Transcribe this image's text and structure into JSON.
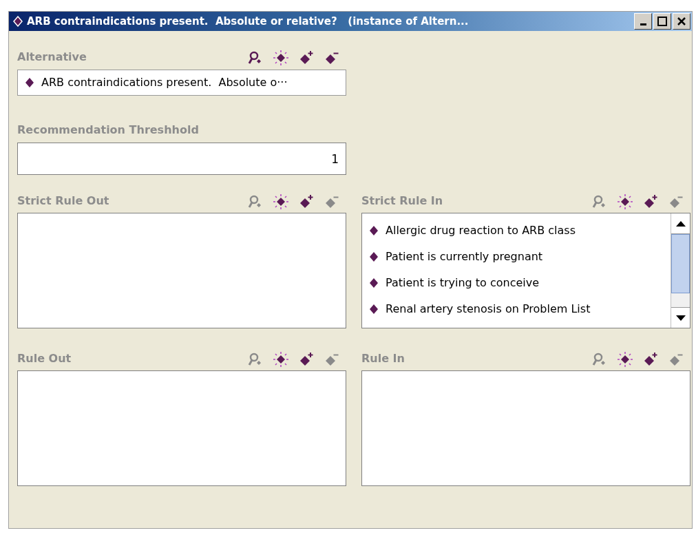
{
  "window": {
    "title": "ARB contraindications present.  Absolute or relative?   (instance of Altern...",
    "buttons": [
      {
        "kind": "minimize"
      },
      {
        "kind": "maximize"
      },
      {
        "kind": "close"
      }
    ]
  },
  "alternative": {
    "label": "Alternative",
    "tools": [
      {
        "kind": "find",
        "disabled": false
      },
      {
        "kind": "view",
        "disabled": false
      },
      {
        "kind": "add",
        "disabled": false
      },
      {
        "kind": "remove",
        "disabled": false
      }
    ],
    "items": [
      "ARB contraindications present.  Absolute o···"
    ]
  },
  "threshold": {
    "label": "Recommendation Threshhold",
    "value": "1"
  },
  "panels": [
    {
      "label": "Strict Rule Out",
      "tools": [
        {
          "kind": "find",
          "disabled": true
        },
        {
          "kind": "view",
          "disabled": false
        },
        {
          "kind": "add",
          "disabled": false
        },
        {
          "kind": "remove",
          "disabled": true
        }
      ]
    },
    {
      "label": "Strict Rule In",
      "tools": [
        {
          "kind": "find",
          "disabled": true
        },
        {
          "kind": "view",
          "disabled": false
        },
        {
          "kind": "add",
          "disabled": false
        },
        {
          "kind": "remove",
          "disabled": true
        }
      ],
      "items": [
        "Allergic drug reaction to ARB class",
        "Patient is currently pregnant",
        "Patient is trying to conceive",
        "Renal artery stenosis on Problem List"
      ]
    },
    {
      "label": "Rule Out",
      "tools": [
        {
          "kind": "find",
          "disabled": true
        },
        {
          "kind": "view",
          "disabled": false
        },
        {
          "kind": "add",
          "disabled": false
        },
        {
          "kind": "remove",
          "disabled": true
        }
      ]
    },
    {
      "label": "Rule In",
      "tools": [
        {
          "kind": "find",
          "disabled": true
        },
        {
          "kind": "view",
          "disabled": false
        },
        {
          "kind": "add",
          "disabled": false
        },
        {
          "kind": "remove",
          "disabled": true
        }
      ]
    }
  ]
}
